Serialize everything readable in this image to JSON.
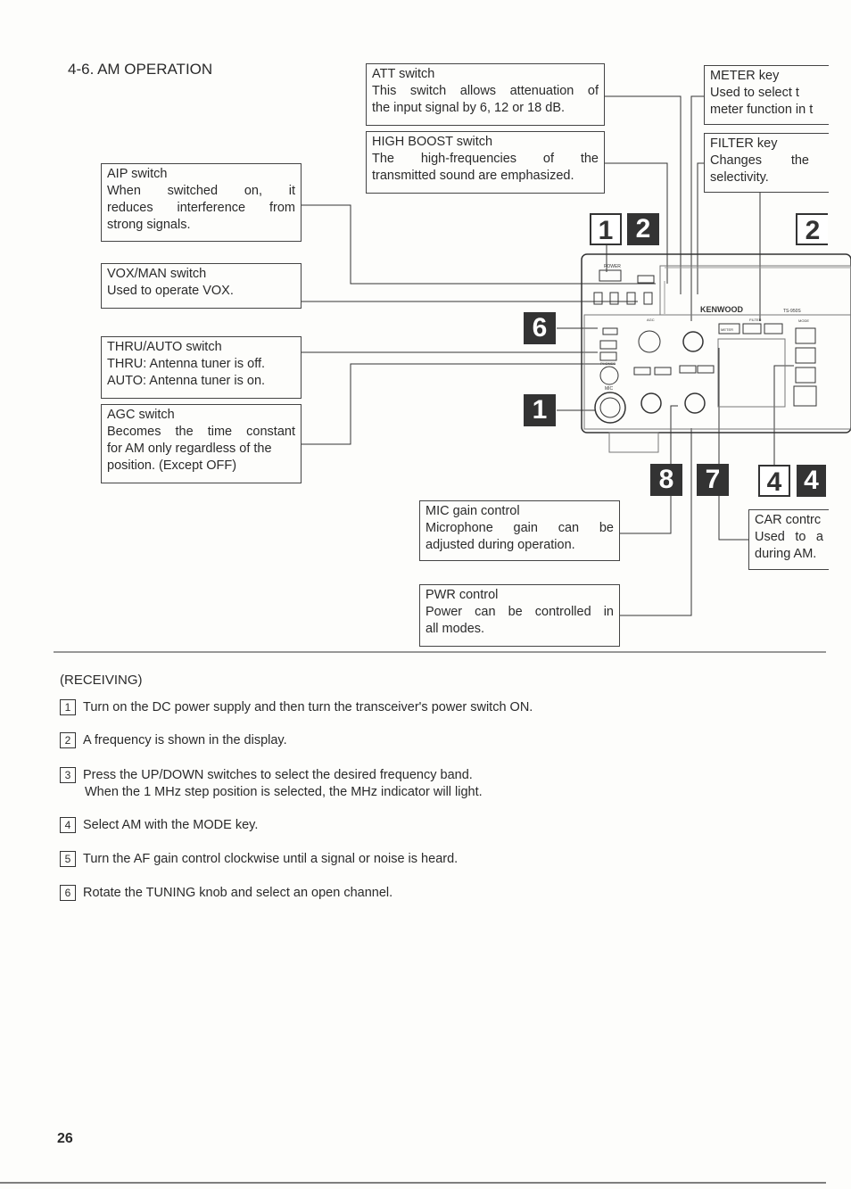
{
  "section_title": "4-6.  AM OPERATION",
  "callouts": {
    "att": {
      "title": "ATT switch",
      "lines": [
        "This switch allows attenuation of",
        "the input signal by 6, 12 or 18 dB."
      ]
    },
    "high_boost": {
      "title": "HIGH BOOST switch",
      "lines": [
        "The high-frequencies of the",
        "transmitted sound are emphasized."
      ]
    },
    "meter": {
      "title": "METER key",
      "lines": [
        "Used to select t",
        "meter function in t"
      ]
    },
    "filter": {
      "title": "FILTER key",
      "lines": [
        "Changes the",
        "selectivity."
      ]
    },
    "aip": {
      "title": "AIP switch",
      "lines": [
        "When switched on, it",
        "reduces interference from",
        "strong signals."
      ]
    },
    "vox": {
      "title": "VOX/MAN switch",
      "lines": [
        "Used to operate VOX."
      ]
    },
    "thru": {
      "title": "THRU/AUTO switch",
      "lines": [
        "THRU: Antenna tuner is off.",
        "AUTO: Antenna tuner is on."
      ]
    },
    "agc": {
      "title": "AGC switch",
      "lines": [
        "Becomes the time constant",
        "for AM only regardless of the",
        "position. (Except OFF)"
      ]
    },
    "mic": {
      "title": "MIC gain control",
      "lines": [
        "Microphone gain can be",
        "adjusted during operation."
      ]
    },
    "pwr": {
      "title": "PWR control",
      "lines": [
        "Power can be controlled in",
        "all modes."
      ]
    },
    "car": {
      "title": "CAR contrc",
      "lines": [
        "Used to a",
        "during AM."
      ]
    }
  },
  "badges": [
    "1",
    "2",
    "2",
    "6",
    "1",
    "8",
    "7",
    "4",
    "4"
  ],
  "radio_panel": {
    "brand": "KENWOOD",
    "model": "TS-950S",
    "labels": [
      "POWER",
      "MIC",
      "PHONES",
      "AGC",
      "FILTER",
      "MODE",
      "METER"
    ]
  },
  "receiving": {
    "heading": "(RECEIVING)",
    "steps": [
      {
        "n": "1",
        "lines": [
          "Turn on the DC power supply and then turn the transceiver's power switch ON."
        ]
      },
      {
        "n": "2",
        "lines": [
          "A frequency is shown in the display."
        ]
      },
      {
        "n": "3",
        "lines": [
          "Press the UP/DOWN switches to select the desired frequency band.",
          "When the 1 MHz step position is selected, the MHz indicator will light."
        ]
      },
      {
        "n": "4",
        "lines": [
          "Select AM with the MODE key."
        ]
      },
      {
        "n": "5",
        "lines": [
          "Turn the AF gain control clockwise until a signal or noise is heard."
        ]
      },
      {
        "n": "6",
        "lines": [
          "Rotate the TUNING knob and select an open channel."
        ]
      }
    ]
  },
  "page_number": "26"
}
